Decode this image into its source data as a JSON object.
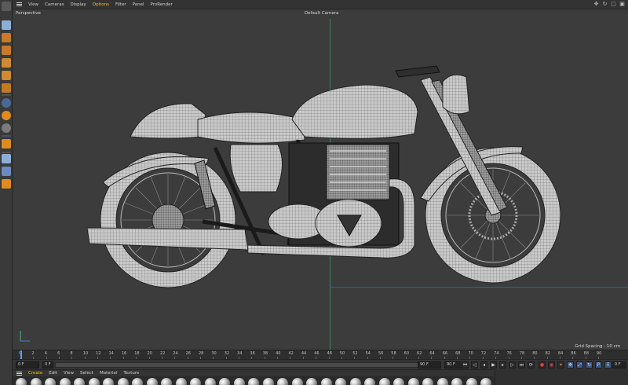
{
  "menubar": {
    "items": [
      "View",
      "Cameras",
      "Display",
      "Options",
      "Filter",
      "Panel",
      "ProRender"
    ],
    "active_index": 3,
    "accent": "#f0c020"
  },
  "viewport": {
    "projection_label": "Perspective",
    "camera_label": "Default Camera",
    "grid_spacing": "Grid Spacing : 10 cm",
    "background": "#3c3c3c"
  },
  "timeline": {
    "ticks": [
      "0",
      "2",
      "4",
      "6",
      "8",
      "10",
      "12",
      "14",
      "16",
      "18",
      "20",
      "22",
      "24",
      "26",
      "28",
      "30",
      "32",
      "34",
      "36",
      "38",
      "40",
      "42",
      "44",
      "46",
      "48",
      "50",
      "52",
      "54",
      "56",
      "58",
      "60",
      "62",
      "64",
      "66",
      "68",
      "70",
      "72",
      "74",
      "76",
      "78",
      "80",
      "82",
      "84",
      "86",
      "88",
      "90"
    ],
    "current_frame": 0
  },
  "transport": {
    "current_frame": "0 F",
    "start_frame": "0 F",
    "end_frame": "90 F",
    "max_frame": "90 F",
    "right_field": "0 F"
  },
  "material_menu": {
    "items": [
      "Create",
      "Edit",
      "View",
      "Select",
      "Material",
      "Texture"
    ],
    "active_index": 0
  },
  "icons": {
    "window": [
      "arrows-move-icon",
      "refresh-icon",
      "frame-icon",
      "split-view-icon"
    ]
  }
}
